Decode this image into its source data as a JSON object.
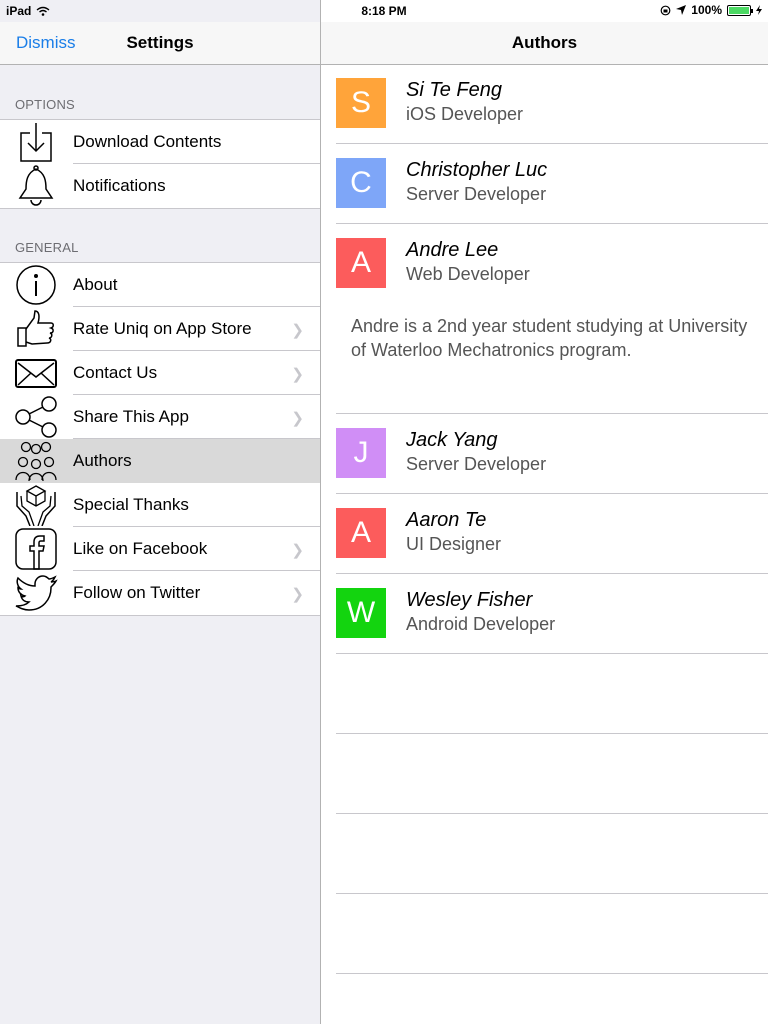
{
  "status_bar": {
    "device": "iPad",
    "time": "8:18 PM",
    "battery": "100%"
  },
  "master": {
    "dismiss_label": "Dismiss",
    "title": "Settings",
    "options_header": "OPTIONS",
    "options": [
      {
        "label": "Download Contents",
        "icon": "download-icon"
      },
      {
        "label": "Notifications",
        "icon": "bell-icon"
      }
    ],
    "general_header": "GENERAL",
    "general": [
      {
        "label": "About",
        "icon": "info-icon"
      },
      {
        "label": "Rate Uniq on App Store",
        "icon": "thumbs-up-icon"
      },
      {
        "label": "Contact Us",
        "icon": "envelope-icon"
      },
      {
        "label": "Share This App",
        "icon": "share-icon"
      },
      {
        "label": "Authors",
        "icon": "people-icon"
      },
      {
        "label": "Special Thanks",
        "icon": "gift-hands-icon"
      },
      {
        "label": "Like on Facebook",
        "icon": "facebook-icon"
      },
      {
        "label": "Follow on Twitter",
        "icon": "twitter-icon"
      }
    ]
  },
  "detail": {
    "title": "Authors",
    "authors": [
      {
        "initial": "S",
        "name": "Si Te Feng",
        "role": "iOS Developer",
        "color": "#ffa43a"
      },
      {
        "initial": "C",
        "name": "Christopher Luc",
        "role": "Server Developer",
        "color": "#7ea6f8"
      },
      {
        "initial": "A",
        "name": "Andre Lee",
        "role": "Web Developer",
        "color": "#fc5c5c",
        "bio": "Andre is a 2nd year student studying at University of Waterloo Mechatronics program."
      },
      {
        "initial": "J",
        "name": "Jack Yang",
        "role": "Server Developer",
        "color": "#d08ef6"
      },
      {
        "initial": "A",
        "name": "Aaron Te",
        "role": "UI Designer",
        "color": "#fc5c5c"
      },
      {
        "initial": "W",
        "name": "Wesley Fisher",
        "role": "Android Developer",
        "color": "#13d40f"
      }
    ]
  },
  "colors": {
    "accent": "#1a7ee8",
    "selected_row": "#d9d9d9",
    "master_background": "#efeff4"
  }
}
